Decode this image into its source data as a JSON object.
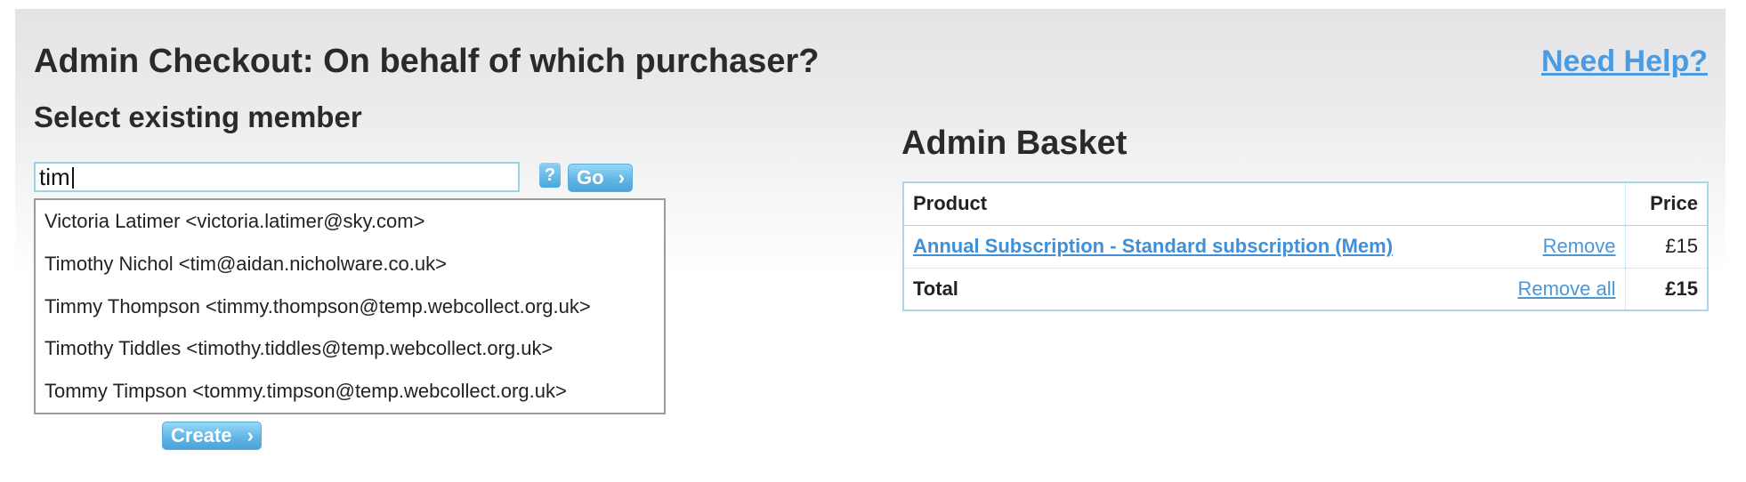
{
  "header": {
    "title": "Admin Checkout: On behalf of which purchaser?",
    "help_link": "Need Help?"
  },
  "member_search": {
    "heading": "Select existing member",
    "input_value": "tim",
    "help_icon_glyph": "?",
    "go_label": "Go",
    "create_label": "Create",
    "suggestions": [
      "Victoria Latimer <victoria.latimer@sky.com>",
      "Timothy Nichol <tim@aidan.nicholware.co.uk>",
      "Timmy Thompson <timmy.thompson@temp.webcollect.org.uk>",
      "Timothy Tiddles <timothy.tiddles@temp.webcollect.org.uk>",
      "Tommy Timpson <tommy.timpson@temp.webcollect.org.uk>"
    ]
  },
  "basket": {
    "title": "Admin Basket",
    "columns": {
      "product": "Product",
      "price": "Price"
    },
    "items": [
      {
        "product": "Annual Subscription - Standard subscription (Mem)",
        "remove_label": "Remove",
        "price": "£15"
      }
    ],
    "total": {
      "label": "Total",
      "remove_all_label": "Remove all",
      "price": "£15"
    }
  },
  "colors": {
    "accent": "#4a9be0",
    "button_blue": "#61b6e6",
    "table_border": "#a9d6ea"
  }
}
